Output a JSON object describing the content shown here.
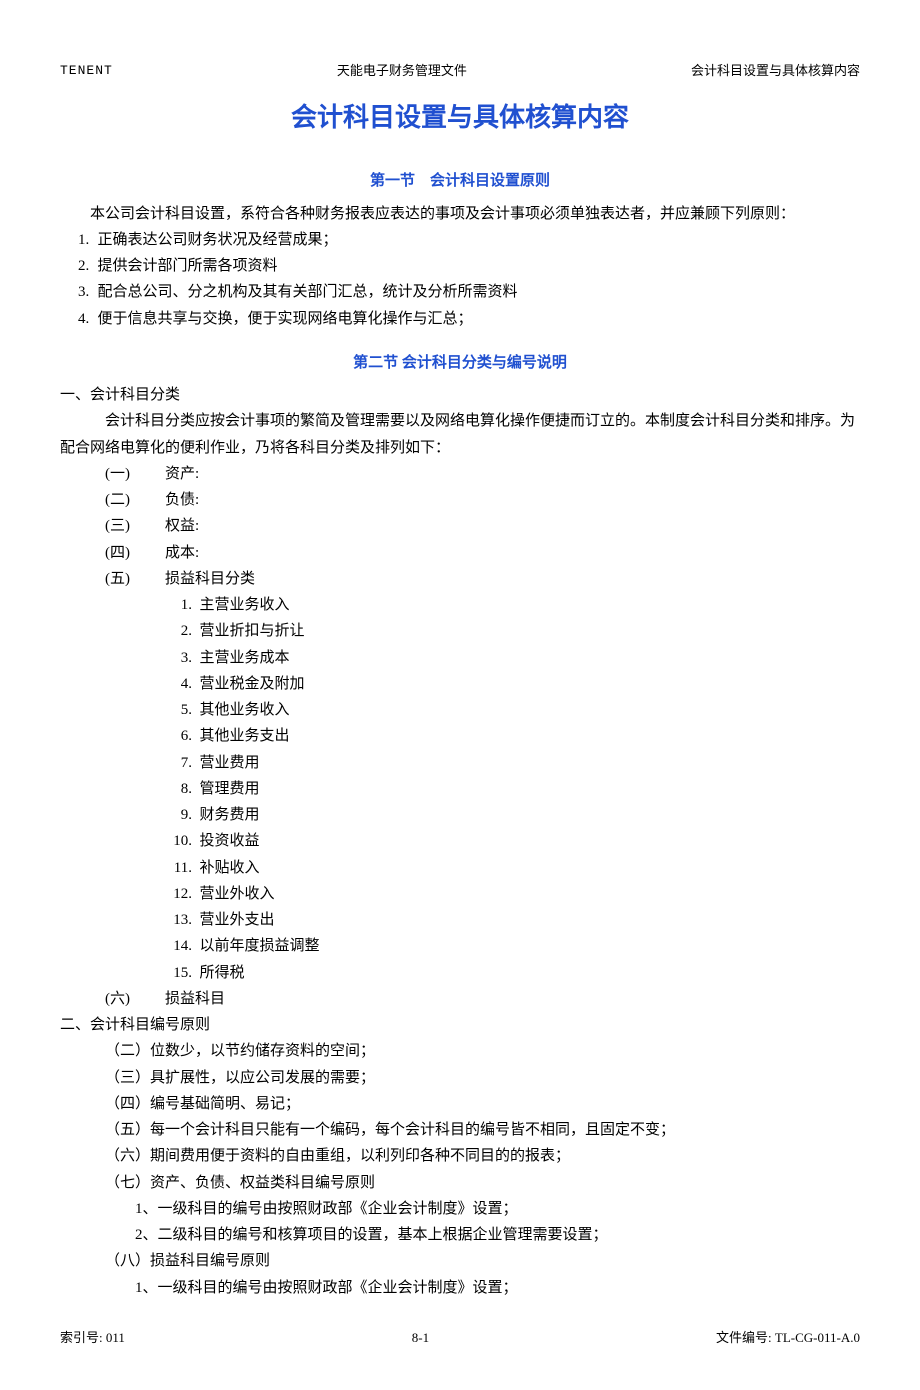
{
  "header": {
    "left": "TENENT",
    "center": "天能电子财务管理文件",
    "right": "会计科目设置与具体核算内容"
  },
  "main_title": "会计科目设置与具体核算内容",
  "section1": {
    "title": "第一节　会计科目设置原则",
    "intro": "本公司会计科目设置，系符合各种财务报表应表达的事项及会计事项必须单独表达者，并应兼顾下列原则：",
    "items": [
      "正确表达公司财务状况及经营成果；",
      "提供会计部门所需各项资料",
      "配合总公司、分之机构及其有关部门汇总，统计及分析所需资料",
      "便于信息共享与交换，便于实现网络电算化操作与汇总；"
    ]
  },
  "section2": {
    "title": "第二节 会计科目分类与编号说明",
    "part1": {
      "heading": "一、会计科目分类",
      "intro": "会计科目分类应按会计事项的繁简及管理需要以及网络电算化操作便捷而订立的。本制度会计科目分类和排序。为配合网络电算化的便利作业，乃将各科目分类及排列如下：",
      "cats": [
        {
          "num": "(一)",
          "label": "资产:"
        },
        {
          "num": "(二)",
          "label": "负债:"
        },
        {
          "num": "(三)",
          "label": "权益:"
        },
        {
          "num": "(四)",
          "label": "成本:"
        },
        {
          "num": "(五)",
          "label": "损益科目分类"
        }
      ],
      "pl_items": [
        "主营业务收入",
        "营业折扣与折让",
        "主营业务成本",
        "营业税金及附加",
        "其他业务收入",
        "其他业务支出",
        "营业费用",
        "管理费用",
        "财务费用",
        "投资收益",
        "补贴收入",
        "营业外收入",
        "营业外支出",
        "以前年度损益调整",
        "所得税"
      ],
      "cat6": {
        "num": "(六)",
        "label": "损益科目"
      }
    },
    "part2": {
      "heading": "二、会计科目编号原则",
      "rules": [
        {
          "num": "（二）",
          "text": "位数少，以节约储存资料的空间；"
        },
        {
          "num": "（三）",
          "text": "具扩展性，以应公司发展的需要；"
        },
        {
          "num": "（四）",
          "text": "编号基础简明、易记；"
        },
        {
          "num": "（五）",
          "text": "每一个会计科目只能有一个编码，每个会计科目的编号皆不相同，且固定不变；"
        },
        {
          "num": "（六）",
          "text": "期间费用便于资料的自由重组，以利列印各种不同目的的报表；"
        },
        {
          "num": "（七）",
          "text": "资产、负债、权益类科目编号原则"
        }
      ],
      "sub7": [
        "1、一级科目的编号由按照财政部《企业会计制度》设置；",
        "2、二级科目的编号和核算项目的设置，基本上根据企业管理需要设置；"
      ],
      "rule8": {
        "num": "（八）",
        "text": "损益科目编号原则"
      },
      "sub8": [
        "1、一级科目的编号由按照财政部《企业会计制度》设置；"
      ]
    }
  },
  "footer": {
    "left": "索引号: 011",
    "center": "8-1",
    "right": "文件编号: TL-CG-011-A.0"
  }
}
